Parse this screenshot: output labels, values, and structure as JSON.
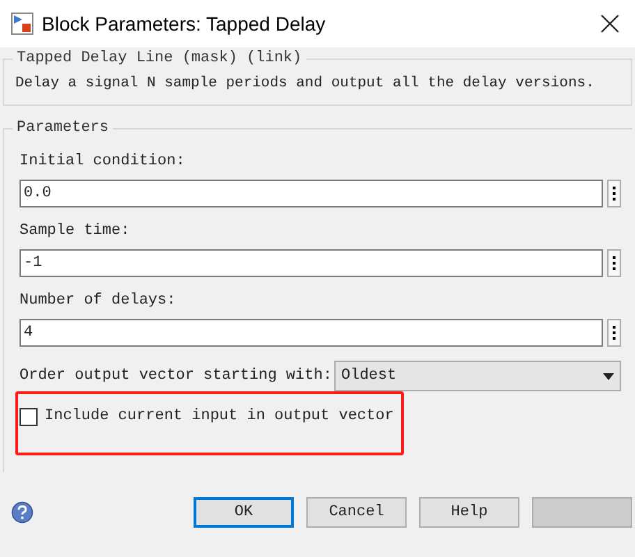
{
  "window": {
    "title": "Block Parameters: Tapped Delay"
  },
  "description_group": {
    "title": "Tapped Delay Line (mask) (link)",
    "text": "Delay a signal N sample periods and output all the delay versions."
  },
  "parameters": {
    "title": "Parameters",
    "fields": [
      {
        "label": "Initial condition:",
        "value": "0.0"
      },
      {
        "label": "Sample time:",
        "value": "-1"
      },
      {
        "label": "Number of delays:",
        "value": "4"
      }
    ],
    "dropdown": {
      "label": "Order output vector starting with:",
      "value": "Oldest"
    },
    "checkbox": {
      "label": "Include current input in output vector",
      "checked": false,
      "highlighted": true
    }
  },
  "buttons": [
    {
      "label": "OK",
      "focused": true,
      "disabled": false
    },
    {
      "label": "Cancel",
      "focused": false,
      "disabled": false
    },
    {
      "label": "Help",
      "focused": false,
      "disabled": false
    },
    {
      "focused": false,
      "disabled": true
    }
  ]
}
